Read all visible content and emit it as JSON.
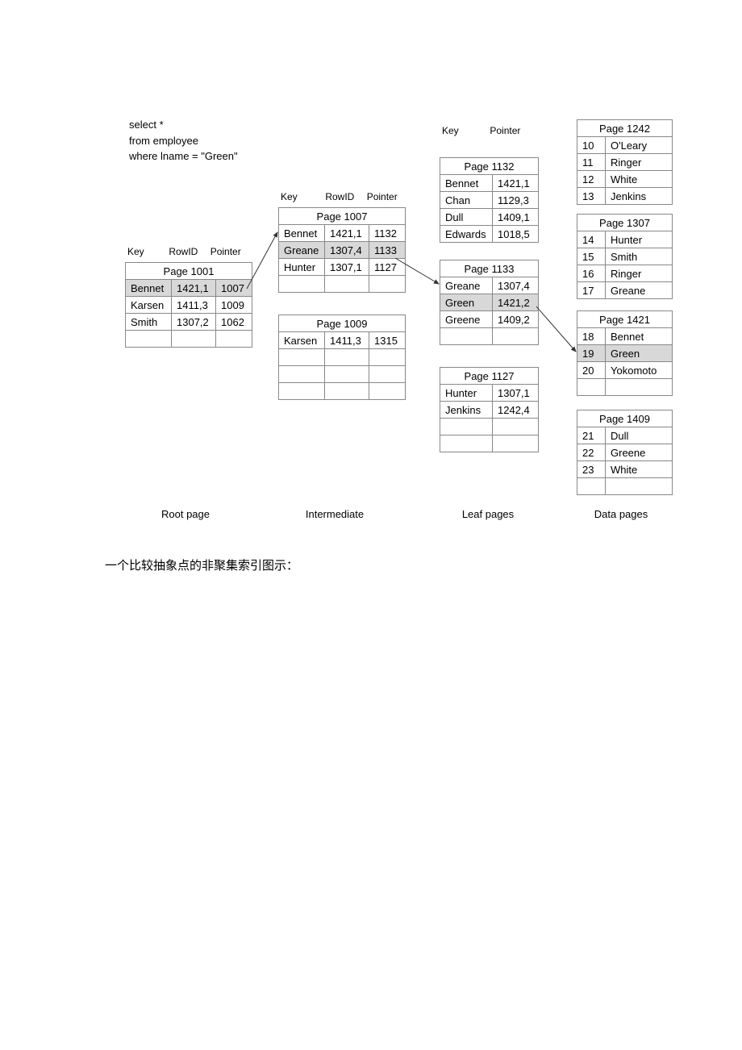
{
  "query": {
    "line1": "select *",
    "line2": "from employee",
    "line3": "where lname = \"Green\""
  },
  "headers": {
    "key": "Key",
    "rowid": "RowID",
    "pointer": "Pointer"
  },
  "root": {
    "title": "Page 1001",
    "rows": [
      {
        "key": "Bennet",
        "rowid": "1421,1",
        "ptr": "1007",
        "hl": true
      },
      {
        "key": "Karsen",
        "rowid": "1411,3",
        "ptr": "1009"
      },
      {
        "key": "Smith",
        "rowid": "1307,2",
        "ptr": "1062"
      },
      {
        "key": "",
        "rowid": "",
        "ptr": ""
      }
    ]
  },
  "inter": [
    {
      "title": "Page 1007",
      "rows": [
        {
          "key": "Bennet",
          "rowid": "1421,1",
          "ptr": "1132"
        },
        {
          "key": "Greane",
          "rowid": "1307,4",
          "ptr": "1133",
          "hl": true
        },
        {
          "key": "Hunter",
          "rowid": "1307,1",
          "ptr": "1127"
        },
        {
          "key": "",
          "rowid": "",
          "ptr": ""
        }
      ]
    },
    {
      "title": "Page 1009",
      "rows": [
        {
          "key": "Karsen",
          "rowid": "1411,3",
          "ptr": "1315"
        },
        {
          "key": "",
          "rowid": "",
          "ptr": ""
        },
        {
          "key": "",
          "rowid": "",
          "ptr": ""
        },
        {
          "key": "",
          "rowid": "",
          "ptr": ""
        }
      ]
    }
  ],
  "leaf": [
    {
      "title": "Page 1132",
      "rows": [
        {
          "key": "Bennet",
          "val": "1421,1"
        },
        {
          "key": "Chan",
          "val": "1129,3"
        },
        {
          "key": "Dull",
          "val": "1409,1"
        },
        {
          "key": "Edwards",
          "val": "1018,5"
        }
      ]
    },
    {
      "title": "Page 1133",
      "rows": [
        {
          "key": "Greane",
          "val": "1307,4"
        },
        {
          "key": "Green",
          "val": "1421,2",
          "hl": true
        },
        {
          "key": "Greene",
          "val": "1409,2"
        },
        {
          "key": "",
          "val": ""
        }
      ]
    },
    {
      "title": "Page 1127",
      "rows": [
        {
          "key": "Hunter",
          "val": "1307,1"
        },
        {
          "key": "Jenkins",
          "val": "1242,4"
        },
        {
          "key": "",
          "val": ""
        },
        {
          "key": "",
          "val": ""
        }
      ]
    }
  ],
  "data": [
    {
      "title": "Page 1242",
      "rows": [
        {
          "id": "10",
          "name": "O'Leary"
        },
        {
          "id": "11",
          "name": "Ringer"
        },
        {
          "id": "12",
          "name": "White"
        },
        {
          "id": "13",
          "name": "Jenkins"
        }
      ]
    },
    {
      "title": "Page 1307",
      "rows": [
        {
          "id": "14",
          "name": "Hunter"
        },
        {
          "id": "15",
          "name": "Smith"
        },
        {
          "id": "16",
          "name": "Ringer"
        },
        {
          "id": "17",
          "name": "Greane"
        }
      ]
    },
    {
      "title": "Page 1421",
      "rows": [
        {
          "id": "18",
          "name": "Bennet"
        },
        {
          "id": "19",
          "name": "Green",
          "hl": true
        },
        {
          "id": "20",
          "name": "Yokomoto"
        },
        {
          "id": "",
          "name": ""
        }
      ]
    },
    {
      "title": "Page 1409",
      "rows": [
        {
          "id": "21",
          "name": "Dull"
        },
        {
          "id": "22",
          "name": "Greene"
        },
        {
          "id": "23",
          "name": "White"
        },
        {
          "id": "",
          "name": ""
        }
      ]
    }
  ],
  "labels": {
    "root": "Root page",
    "inter": "Intermediate",
    "leaf": "Leaf pages",
    "data": "Data pages"
  },
  "caption": "一个比较抽象点的非聚集索引图示："
}
